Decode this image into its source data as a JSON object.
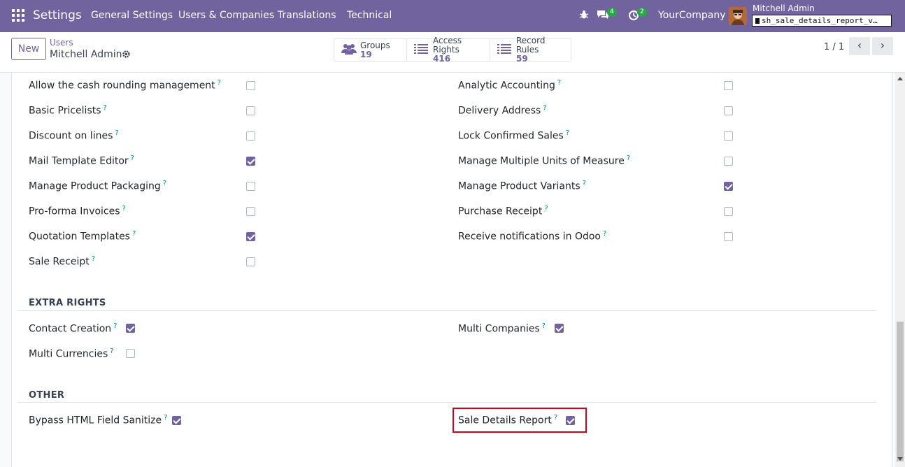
{
  "navbar": {
    "brand": "Settings",
    "menu": [
      "General Settings",
      "Users & Companies",
      "Translations",
      "Technical"
    ],
    "bug_icon": "bug-icon",
    "messages_badge": "4",
    "activities_badge": "2",
    "company": "YourCompany",
    "user_name": "Mitchell Admin",
    "db_name": "sh_sale_details_report_v…"
  },
  "control": {
    "new_label": "New",
    "breadcrumb_parent": "Users",
    "breadcrumb_current": "Mitchell Admin",
    "stats": [
      {
        "label": "Groups",
        "value": "19",
        "icon": "users-icon"
      },
      {
        "label": "Access Rights",
        "value": "416",
        "icon": "list-icon"
      },
      {
        "label": "Record Rules",
        "value": "59",
        "icon": "list-icon"
      }
    ],
    "pager": "1 / 1"
  },
  "rights": {
    "left": [
      {
        "label": "Allow the cash rounding management",
        "checked": false
      },
      {
        "label": "Basic Pricelists",
        "checked": false
      },
      {
        "label": "Discount on lines",
        "checked": false
      },
      {
        "label": "Mail Template Editor",
        "checked": true
      },
      {
        "label": "Manage Product Packaging",
        "checked": false
      },
      {
        "label": "Pro-forma Invoices",
        "checked": false
      },
      {
        "label": "Quotation Templates",
        "checked": true
      },
      {
        "label": "Sale Receipt",
        "checked": false
      }
    ],
    "right": [
      {
        "label": "Analytic Accounting",
        "checked": false
      },
      {
        "label": "Delivery Address",
        "checked": false
      },
      {
        "label": "Lock Confirmed Sales",
        "checked": false
      },
      {
        "label": "Manage Multiple Units of Measure",
        "checked": false
      },
      {
        "label": "Manage Product Variants",
        "checked": true
      },
      {
        "label": "Purchase Receipt",
        "checked": false
      },
      {
        "label": "Receive notifications in Odoo",
        "checked": false
      }
    ]
  },
  "extra_rights": {
    "title": "EXTRA RIGHTS",
    "items": [
      {
        "label": "Contact Creation",
        "checked": true
      },
      {
        "label": "Multi Companies",
        "checked": true
      },
      {
        "label": "Multi Currencies",
        "checked": false
      }
    ]
  },
  "other": {
    "title": "OTHER",
    "items": [
      {
        "label": "Bypass HTML Field Sanitize",
        "checked": true
      },
      {
        "label": "Sale Details Report",
        "checked": true
      }
    ]
  },
  "help_mark": "?",
  "colors": {
    "primary": "#71639e",
    "help": "#017e84",
    "highlight": "#d0021b"
  }
}
